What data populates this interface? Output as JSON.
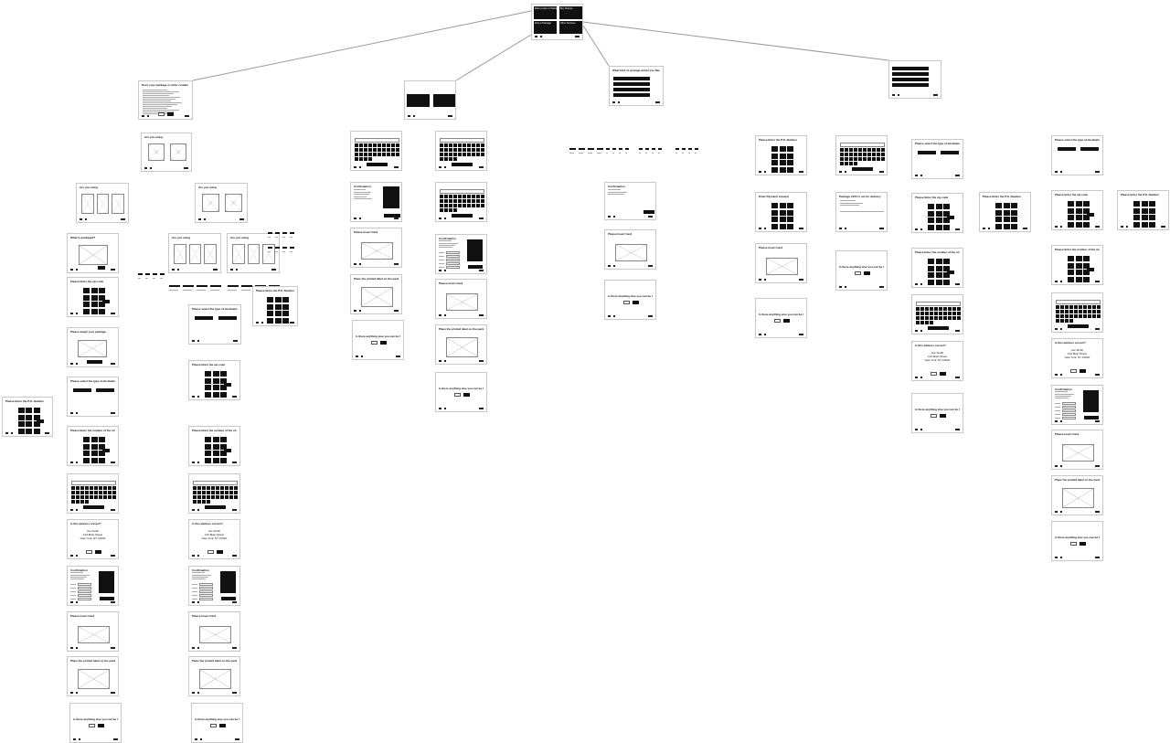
{
  "diagram": {
    "root_menu": {
      "items": [
        {
          "label": "Mail a Letter or Package",
          "lines": [
            "",
            ""
          ]
        },
        {
          "label": "Buy Stamps",
          "lines": [
            "",
            ""
          ]
        },
        {
          "label": "Drop a Package",
          "lines": [
            "",
            ""
          ]
        },
        {
          "label": "Other Services",
          "lines": [
            "",
            ""
          ]
        }
      ]
    },
    "branch_mail": {
      "prompt": "Does your package or letter contain the following:",
      "cancel_label": "",
      "ok_label": ""
    },
    "branch_drop": {
      "options": [
        "",
        ""
      ]
    },
    "branch_stamps": {
      "prompt": "What kind of postage would you like to purchase",
      "options": [
        "",
        "",
        "",
        ""
      ]
    },
    "branch_other": {
      "prompt": "",
      "options": [
        "",
        "",
        "",
        ""
      ]
    },
    "screens": {
      "are_you_using": "Are you using",
      "what_is_packaged": "What is packaged?",
      "enter_zip": "Please Enter the zip code",
      "weigh_package": "Please weigh your package",
      "select_destination": "Please select the type of destination",
      "enter_street_number": "Please Enter the number of the street",
      "enter_street_name": "Please Enter the Street Name",
      "address_correct": "Is this address correct?",
      "confirmation": "Confirmation",
      "insert_card": "Please insert Card",
      "place_label": "Place the printed label on the package",
      "anything_else": "Is there anything else you can be helped with?",
      "enter_po_box": "Please Enter the P.O. Number",
      "enter_tracking": "Please Enter the Confirmation Number",
      "enter_recipient": "Please Enter the Name of the Recipient",
      "enter_amount": "Enter Payment Amount",
      "package_tracking": "Package #### is out for delivery"
    },
    "address": {
      "name": "Joe Smith",
      "street": "123 Main Street",
      "city": "New York, NY 10020"
    },
    "answers": {
      "no": "",
      "yes": ""
    },
    "print_button": ""
  }
}
